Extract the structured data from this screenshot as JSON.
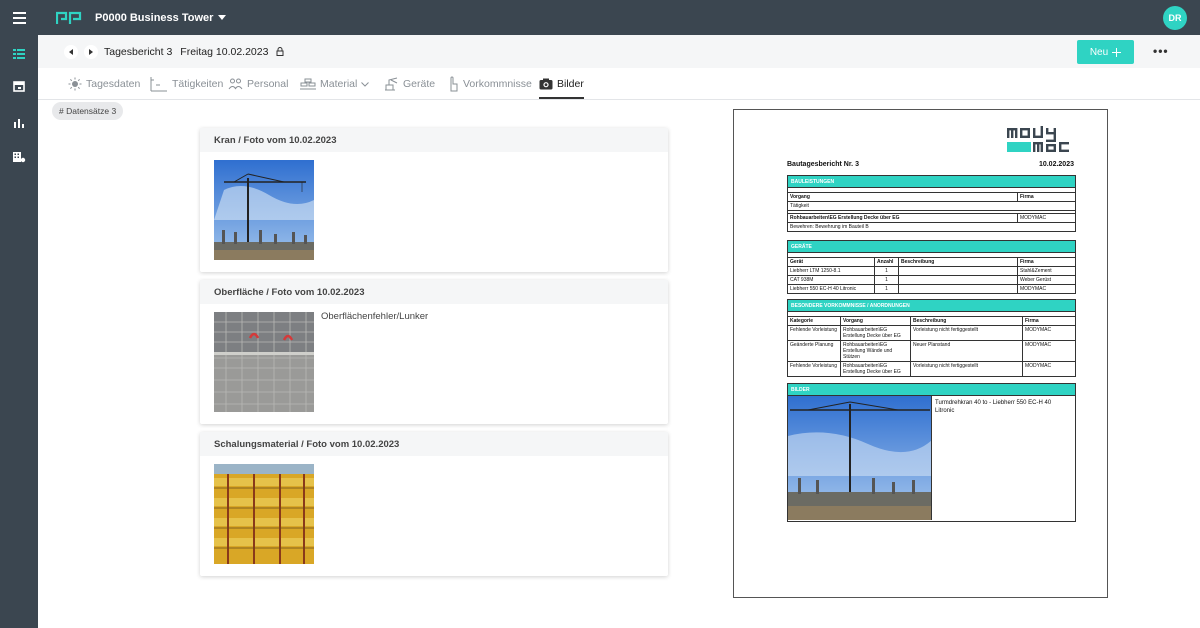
{
  "header": {
    "project": "P0000 Business Tower",
    "avatar": "DR"
  },
  "subheader": {
    "report": "Tagesbericht 3",
    "date": "Freitag 10.02.2023",
    "new_label": "Neu",
    "more_label": "•••"
  },
  "tabs": [
    {
      "label": "Tagesdaten",
      "icon": "sun-icon"
    },
    {
      "label": "Tätigkeiten",
      "icon": "activities-icon"
    },
    {
      "label": "Personal",
      "icon": "people-icon"
    },
    {
      "label": "Material",
      "icon": "material-icon"
    },
    {
      "label": "Geräte",
      "icon": "crane-icon"
    },
    {
      "label": "Vorkommnisse",
      "icon": "hand-icon"
    },
    {
      "label": "Bilder",
      "icon": "camera-icon"
    }
  ],
  "chip": "# Datensätze 3",
  "cards": [
    {
      "title": "Kran / Foto vom 10.02.2023",
      "desc": ""
    },
    {
      "title": "Oberfläche / Foto vom 10.02.2023",
      "desc": "Oberflächenfehler/Lunker"
    },
    {
      "title": "Schalungsmaterial / Foto vom 10.02.2023",
      "desc": ""
    }
  ],
  "report": {
    "title": "Bautagesbericht Nr. 3",
    "date": "10.02.2023",
    "leistungen": {
      "head": "BAULEISTUNGEN",
      "col_vorgang": "Vorgang",
      "col_firma": "Firma",
      "taetigkeit": "Tätigkeit",
      "row_vorgang": "Rohbauarbeiten\\EG Erstellung Decke über EG",
      "row_firma": "MODYMAC",
      "row_sub": "Bewehren: Bewehrung im Bauteil B"
    },
    "geraete": {
      "head": "GERÄTE",
      "cols": [
        "Gerät",
        "Anzahl",
        "Beschreibung",
        "Firma"
      ],
      "rows": [
        [
          "Liebherr LTM 1250-8.1",
          "1",
          "",
          "Stahl&Zement"
        ],
        [
          "CAT 938M",
          "1",
          "",
          "Weber Gerüst"
        ],
        [
          "Liebherr 550 EC-H 40 Litronic",
          "1",
          "",
          "MODYMAC"
        ]
      ]
    },
    "vorkommnisse": {
      "head": "BESONDERE VORKOMMNISSE / ANORDNUNGEN",
      "cols": [
        "Kategorie",
        "Vorgang",
        "Beschreibung",
        "Firma"
      ],
      "rows": [
        [
          "Fehlende Vorleistung",
          "Rohbauarbeiten\\EG Erstellung Decke über EG",
          "Vorleistung nicht fertiggestellt",
          "MODYMAC"
        ],
        [
          "Geänderte Planung",
          "Rohbauarbeiten\\EG Erstellung Wände und Stützen",
          "Neuer Planstand",
          "MODYMAC"
        ],
        [
          "Fehlende Vorleistung",
          "Rohbauarbeiten\\EG Erstellung Decke über EG",
          "Vorleistung nicht fertiggestellt",
          "MODYMAC"
        ]
      ]
    },
    "bilder": {
      "head": "BILDER",
      "caption": "Turmdrehkran 40 to - Liebherr 550 EC-H 40 Litronic"
    }
  },
  "colors": {
    "accent": "#2fd3c3",
    "dark": "#3b4650"
  }
}
